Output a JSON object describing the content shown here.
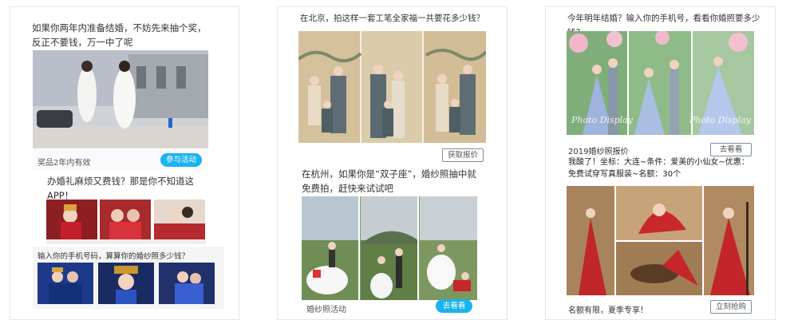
{
  "card1": {
    "headline": "如果你两年内准备结婚，不妨先来抽个奖，反正不要钱，万一中了呢",
    "prize_note": "奖品2年内有效",
    "join_button": "参与活动",
    "sub_headline": "办婚礼麻烦又费钱？那是你不知道这APP！",
    "phone_prompt": "输入你的手机号码，算算你的婚纱照多少钱？"
  },
  "card2": {
    "headline": "在北京，拍这样一套工笔全家福一共要花多少钱？",
    "quote_button": "获取报价",
    "sub_headline": "在杭州，如果你是“双子座”，婚纱照抽中就免费拍，赶快来试试吧",
    "footer_label": "婚纱照活动",
    "look_button": "去看看"
  },
  "card3": {
    "headline": "今年明年结婚？输入你的手机号，看看你婚照要多少钱？",
    "watermark_1": "Photo Display",
    "watermark_2": "Photo Display",
    "price_label": "2019婚纱照报价",
    "look_button": "去看看",
    "description": "我酸了！坐标：大连~条件：爱美的小仙女~优惠：免费试穿写真服装~名额：30个",
    "footer_label": "名额有限，夏季专享！",
    "buy_button": "立刻抢购"
  },
  "colors": {
    "accent": "#1ab3f0",
    "border": "#e6e6e6"
  }
}
